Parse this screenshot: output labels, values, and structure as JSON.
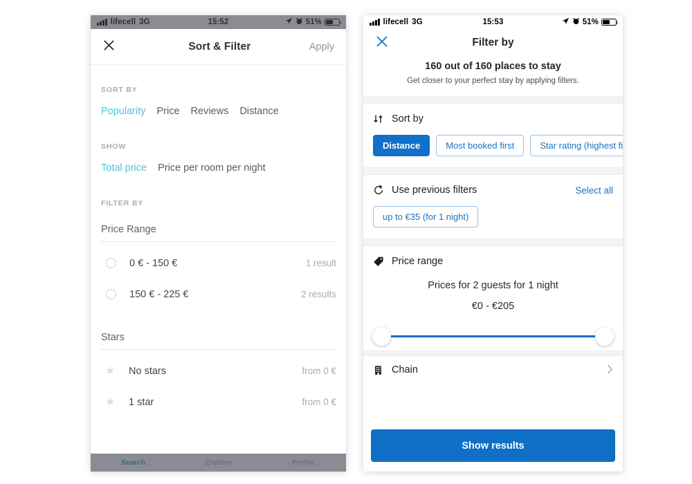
{
  "accent": {
    "teal": "#4cc4da",
    "blue": "#1170c9",
    "cta_blue": "#0f6fc6",
    "link_blue": "#1a73c4"
  },
  "left_phone": {
    "status_bar": {
      "carrier": "lifecell",
      "network": "3G",
      "time": "15:52",
      "battery_pct": "51%",
      "icons": [
        "signal-bars-icon",
        "location-arrow-icon",
        "alarm-clock-icon",
        "battery-icon"
      ]
    },
    "header": {
      "close_icon": "close-icon",
      "title": "Sort & Filter",
      "apply_label": "Apply"
    },
    "sort_by": {
      "label": "SORT BY",
      "options": [
        "Popularity",
        "Price",
        "Reviews",
        "Distance"
      ],
      "selected": "Popularity"
    },
    "show": {
      "label": "SHOW",
      "options": [
        "Total price",
        "Price per room per night"
      ],
      "selected": "Total price"
    },
    "filter_by": {
      "label": "FILTER BY"
    },
    "price_range": {
      "field_label": "Price Range",
      "rows": [
        {
          "label": "0 € - 150 €",
          "meta": "1 result",
          "selected": false
        },
        {
          "label": "150 € - 225 €",
          "meta": "2 results",
          "selected": false
        }
      ]
    },
    "stars": {
      "field_label": "Stars",
      "rows": [
        {
          "label": "No stars",
          "meta": "from 0 €",
          "icon": "star-icon"
        },
        {
          "label": "1 star",
          "meta": "from 0 €",
          "icon": "star-icon"
        }
      ]
    },
    "tab_bar": {
      "items": [
        "Search",
        "Explore",
        "Profile"
      ],
      "active": "Search"
    }
  },
  "right_phone": {
    "status_bar": {
      "carrier": "lifecell",
      "network": "3G",
      "time": "15:53",
      "battery_pct": "51%",
      "icons": [
        "signal-bars-icon",
        "location-arrow-icon",
        "alarm-clock-icon",
        "battery-icon"
      ]
    },
    "header": {
      "close_icon": "close-icon",
      "title": "Filter by"
    },
    "summary": {
      "headline": "160 out of 160 places to stay",
      "subline": "Get closer to your perfect stay by applying filters."
    },
    "sort_by": {
      "icon": "sort-arrows-icon",
      "title": "Sort by",
      "chips": [
        {
          "label": "Distance",
          "selected": true
        },
        {
          "label": "Most booked first",
          "selected": false
        },
        {
          "label": "Star rating (highest fi",
          "selected": false
        }
      ]
    },
    "previous_filters": {
      "icon": "history-icon",
      "title": "Use previous filters",
      "link": "Select all",
      "chips": [
        {
          "label": "up to €35 (for 1 night)",
          "selected": false
        }
      ]
    },
    "price_range": {
      "icon": "tag-icon",
      "title": "Price range",
      "guests_line": "Prices for 2 guests for 1 night",
      "value_line": "€0 - €205",
      "slider": {
        "min_label": "€0",
        "max_label": "€205",
        "lo_pct": 0,
        "hi_pct": 100
      }
    },
    "chain": {
      "icon": "building-icon",
      "title": "Chain",
      "chevron": "chevron-right-icon"
    },
    "cta": {
      "label": "Show results"
    }
  }
}
